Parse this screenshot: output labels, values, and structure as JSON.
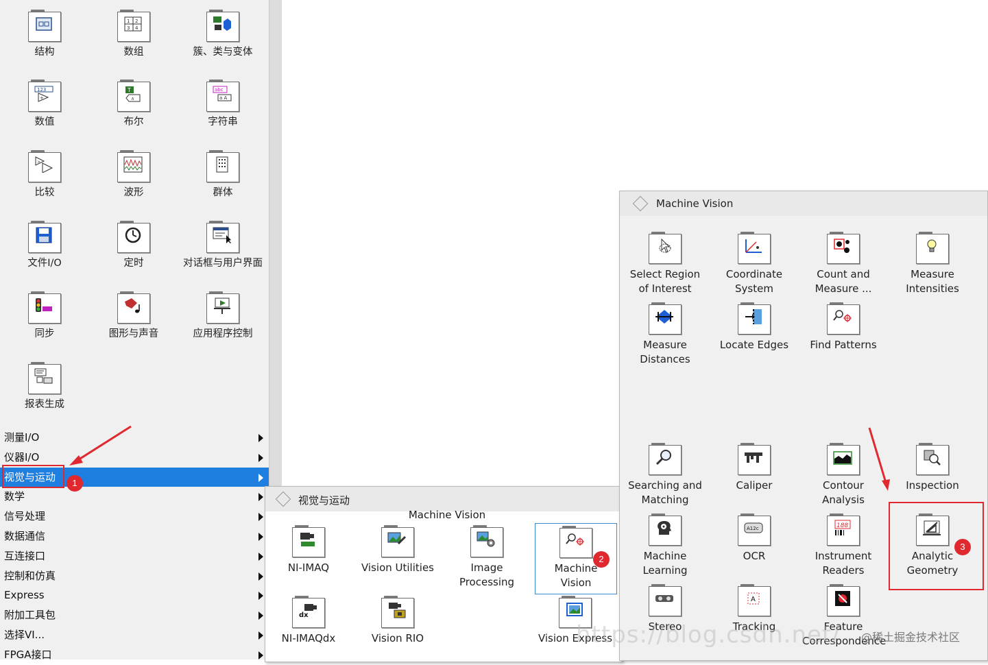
{
  "palette": {
    "items": [
      {
        "label": "结构",
        "icon": "structures-icon"
      },
      {
        "label": "数组",
        "icon": "array-icon"
      },
      {
        "label": "簇、类与变体",
        "icon": "cluster-class-variant-icon"
      },
      {
        "label": "数值",
        "icon": "numeric-icon"
      },
      {
        "label": "布尔",
        "icon": "boolean-icon"
      },
      {
        "label": "字符串",
        "icon": "string-icon"
      },
      {
        "label": "比较",
        "icon": "comparison-icon"
      },
      {
        "label": "波形",
        "icon": "waveform-icon"
      },
      {
        "label": "群体",
        "icon": "collection-icon"
      },
      {
        "label": "文件I/O",
        "icon": "file-io-icon"
      },
      {
        "label": "定时",
        "icon": "timing-icon"
      },
      {
        "label": "对话框与用户界面",
        "icon": "dialog-ui-icon"
      },
      {
        "label": "同步",
        "icon": "synchronization-icon"
      },
      {
        "label": "图形与声音",
        "icon": "graphics-sound-icon"
      },
      {
        "label": "应用程序控制",
        "icon": "application-control-icon"
      },
      {
        "label": "报表生成",
        "icon": "report-generation-icon"
      }
    ],
    "categories": [
      {
        "label": "测量I/O"
      },
      {
        "label": "仪器I/O"
      },
      {
        "label": "视觉与运动",
        "selected": true
      },
      {
        "label": "数学"
      },
      {
        "label": "信号处理"
      },
      {
        "label": "数据通信"
      },
      {
        "label": "互连接口"
      },
      {
        "label": "控制和仿真"
      },
      {
        "label": "Express"
      },
      {
        "label": "附加工具包"
      },
      {
        "label": "选择VI..."
      },
      {
        "label": "FPGA接口"
      }
    ]
  },
  "vision_motion": {
    "title": "视觉与运动",
    "section_header": "Machine Vision",
    "items": [
      {
        "label1": "NI-IMAQ",
        "label2": "",
        "icon": "ni-imaq-icon"
      },
      {
        "label1": "Vision Utilities",
        "label2": "",
        "icon": "vision-utilities-icon"
      },
      {
        "label1": "Image",
        "label2": "Processing",
        "icon": "image-processing-icon"
      },
      {
        "label1": "Machine",
        "label2": "Vision",
        "icon": "machine-vision-icon"
      },
      {
        "label1": "NI-IMAQdx",
        "label2": "",
        "icon": "ni-imaqdx-icon"
      },
      {
        "label1": "Vision RIO",
        "label2": "",
        "icon": "vision-rio-icon"
      },
      {
        "label1": "Vision Express",
        "label2": "",
        "icon": "vision-express-icon"
      }
    ]
  },
  "machine_vision": {
    "title": "Machine Vision",
    "items": [
      {
        "label1": "Select Region",
        "label2": "of Interest",
        "icon": "select-roi-icon"
      },
      {
        "label1": "Coordinate",
        "label2": "System",
        "icon": "coordinate-system-icon"
      },
      {
        "label1": "Count and",
        "label2": "Measure ...",
        "icon": "count-measure-icon"
      },
      {
        "label1": "Measure",
        "label2": "Intensities",
        "icon": "measure-intensities-icon"
      },
      {
        "label1": "Measure",
        "label2": "Distances",
        "icon": "measure-distances-icon"
      },
      {
        "label1": "Locate Edges",
        "label2": "",
        "icon": "locate-edges-icon"
      },
      {
        "label1": "Find Patterns",
        "label2": "",
        "icon": "find-patterns-icon"
      },
      {
        "label1": "Searching and",
        "label2": "Matching",
        "icon": "searching-matching-icon"
      },
      {
        "label1": "Caliper",
        "label2": "",
        "icon": "caliper-icon"
      },
      {
        "label1": "Contour",
        "label2": "Analysis",
        "icon": "contour-analysis-icon"
      },
      {
        "label1": "Inspection",
        "label2": "",
        "icon": "inspection-icon"
      },
      {
        "label1": "Machine",
        "label2": "Learning",
        "icon": "machine-learning-icon"
      },
      {
        "label1": "OCR",
        "label2": "",
        "icon": "ocr-icon"
      },
      {
        "label1": "Instrument",
        "label2": "Readers",
        "icon": "instrument-readers-icon"
      },
      {
        "label1": "Analytic",
        "label2": "Geometry",
        "icon": "analytic-geometry-icon"
      },
      {
        "label1": "Stereo",
        "label2": "",
        "icon": "stereo-icon"
      },
      {
        "label1": "Tracking",
        "label2": "",
        "icon": "tracking-icon"
      },
      {
        "label1": "Feature",
        "label2": "Correspondence",
        "icon": "feature-correspondence-icon"
      }
    ]
  },
  "annotations": {
    "badges": [
      "1",
      "2",
      "3"
    ],
    "accent": "#e0282f"
  },
  "watermark": {
    "url": "https://blog.csdn.net/",
    "site": "@稀土掘金技术社区"
  }
}
